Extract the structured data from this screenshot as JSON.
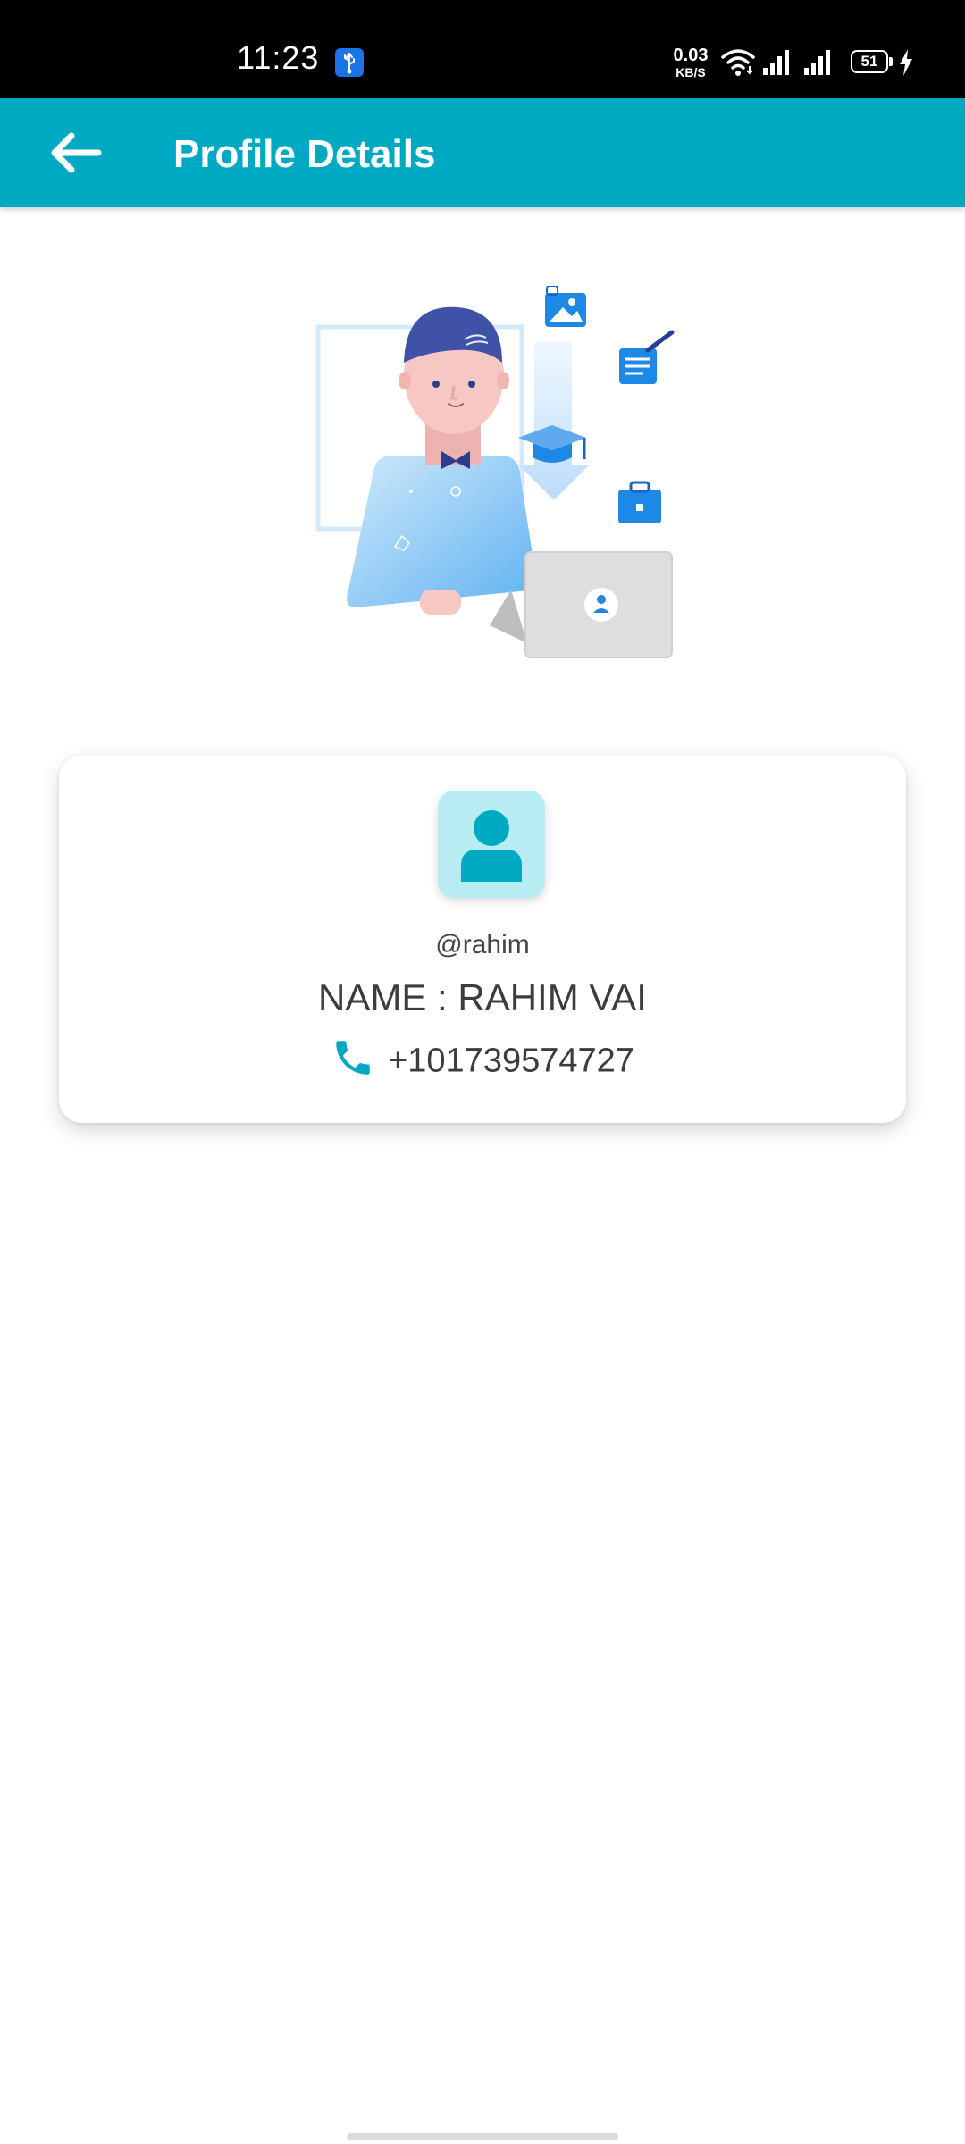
{
  "status_bar": {
    "time": "11:23",
    "net_speed_value": "0.03",
    "net_speed_unit": "KB/S",
    "battery_level": "51",
    "icons": [
      "usb-debug-icon",
      "wifi-icon",
      "signal-icon",
      "signal-icon",
      "battery-icon",
      "charging-bolt-icon"
    ]
  },
  "app_bar": {
    "title": "Profile Details",
    "back_icon": "arrow-left-icon",
    "background_color": "#00a9c2"
  },
  "illustration": {
    "icon": "profile-illustration"
  },
  "profile": {
    "username": "@rahim",
    "name": "NAME : RAHIM VAI",
    "phone": "+101739574727",
    "avatar_icon": "person-icon",
    "phone_icon": "phone-icon",
    "accent_color": "#00a9c2",
    "avatar_bg_color": "#b7edf2"
  }
}
